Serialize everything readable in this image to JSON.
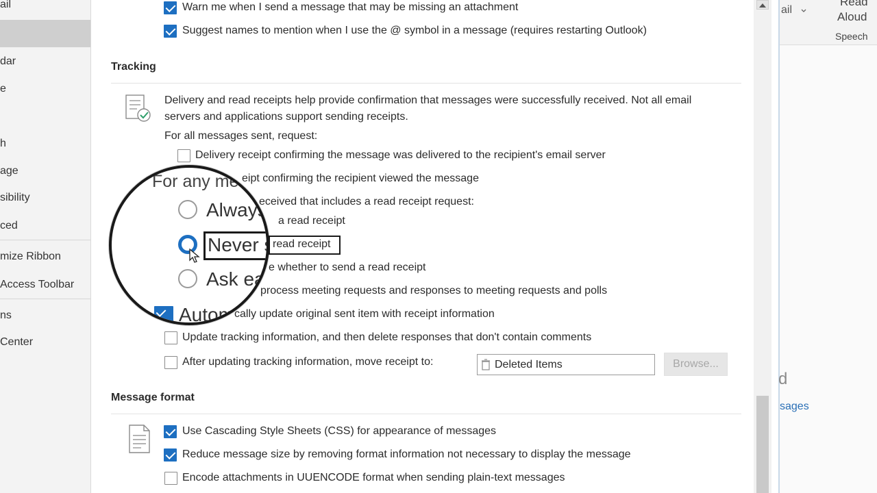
{
  "sidebar": {
    "items": [
      {
        "label": "ail"
      },
      {
        "label": ""
      },
      {
        "label": "dar"
      },
      {
        "label": "e"
      },
      {
        "label": "h"
      },
      {
        "label": "age"
      },
      {
        "label": "sibility"
      },
      {
        "label": "ced"
      },
      {
        "label": "mize Ribbon"
      },
      {
        "label": "Access Toolbar"
      },
      {
        "label": "ns"
      },
      {
        "label": "Center"
      }
    ]
  },
  "compose": {
    "warn_attachment": {
      "label": "Warn me when I send a message that may be missing an attachment",
      "checked": true
    },
    "suggest_names": {
      "label": "Suggest names to mention when I use the @ symbol in a message (requires restarting Outlook)",
      "checked": true
    }
  },
  "tracking": {
    "heading": "Tracking",
    "description_line1": "Delivery and read receipts help provide confirmation that messages were successfully received. Not all email",
    "description_line2": "servers and applications support sending receipts.",
    "request_label": "For all messages sent, request:",
    "delivery_receipt": {
      "label": "Delivery receipt confirming the message was delivered to the recipient's email server",
      "checked": false
    },
    "read_receipt_partial": "eipt confirming the recipient viewed the message",
    "any_message_partial": "eceived that includes a read receipt request:",
    "always_partial": "a read receipt",
    "never_partial": "read receipt",
    "ask_partial": "e whether to send a read receipt",
    "process_partial": "process meeting requests and responses to meeting requests and polls",
    "auto_update_partial": "cally update original sent item with receipt information",
    "update_tracking": {
      "label": "Update tracking information, and then delete responses that don't contain comments",
      "checked": false
    },
    "move_receipt": {
      "label": "After updating tracking information, move receipt to:",
      "checked": false
    },
    "folder_value": "Deleted Items",
    "browse_label": "Browse..."
  },
  "magnifier": {
    "heading": "For any me",
    "always": "Always",
    "never": "Never s",
    "ask": "Ask ea",
    "auto": "Autom",
    "selected_option": "never"
  },
  "message_format": {
    "heading": "Message format",
    "use_css": {
      "label": "Use Cascading Style Sheets (CSS) for appearance of messages",
      "checked": true
    },
    "reduce_size": {
      "label": "Reduce message size by removing format information not necessary to display the message",
      "checked": true
    },
    "uuencode": {
      "label": "Encode attachments in UUENCODE format when sending plain-text messages",
      "checked": false
    }
  },
  "right_panel": {
    "ribbon_dropdown": "ail",
    "read_aloud_top": "Read",
    "read_aloud_bottom": "Aloud",
    "speech_group": "Speech",
    "bg_text_d": "d",
    "bg_text_messages": "sages"
  },
  "colors": {
    "accent": "#1d6fc1",
    "link": "#2a6fb6"
  }
}
